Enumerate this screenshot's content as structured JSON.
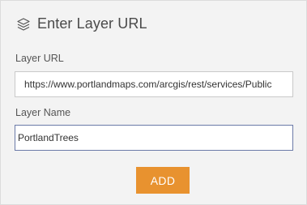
{
  "dialog": {
    "title": "Enter Layer URL",
    "icon": "layers-icon"
  },
  "layer_url": {
    "label": "Layer URL",
    "value": "https://www.portlandmaps.com/arcgis/rest/services/Public"
  },
  "layer_name": {
    "label": "Layer Name",
    "value": "PortlandTrees"
  },
  "actions": {
    "add_label": "ADD",
    "accent": "#e8922f"
  }
}
